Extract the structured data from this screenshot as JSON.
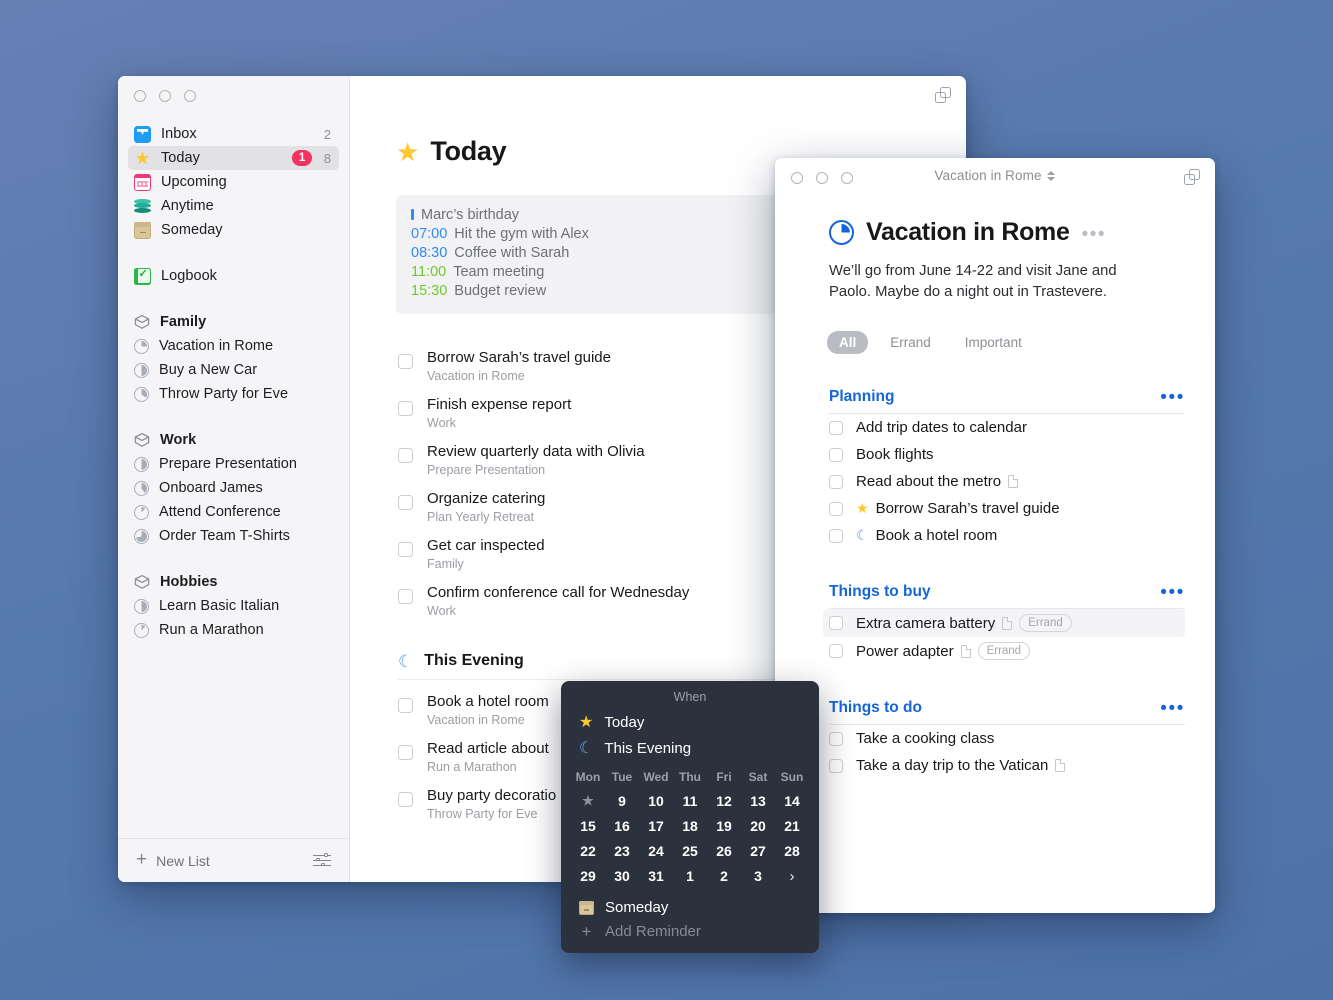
{
  "main_window": {
    "title": "",
    "duplicate_icon": "duplicate-icon",
    "sidebar": {
      "nav": [
        {
          "label": "Inbox",
          "icon": "inbox-icon",
          "count": "2",
          "badge": "",
          "selected": false
        },
        {
          "label": "Today",
          "icon": "star-icon",
          "count": "8",
          "badge": "1",
          "selected": true
        },
        {
          "label": "Upcoming",
          "icon": "calendar-icon",
          "count": "",
          "badge": "",
          "selected": false
        },
        {
          "label": "Anytime",
          "icon": "layers-icon",
          "count": "",
          "badge": "",
          "selected": false
        },
        {
          "label": "Someday",
          "icon": "archive-icon",
          "count": "",
          "badge": "",
          "selected": false
        },
        {
          "label": "Logbook",
          "icon": "logbook-icon",
          "count": "",
          "badge": "",
          "selected": false
        }
      ],
      "areas": [
        {
          "label": "Family",
          "icon": "area-icon",
          "projects": [
            {
              "label": "Vacation in Rome",
              "progress": 25
            },
            {
              "label": "Buy a New Car",
              "progress": 50
            },
            {
              "label": "Throw Party for Eve",
              "progress": 35
            }
          ]
        },
        {
          "label": "Work",
          "icon": "area-icon",
          "projects": [
            {
              "label": "Prepare Presentation",
              "progress": 50
            },
            {
              "label": "Onboard James",
              "progress": 40
            },
            {
              "label": "Attend Conference",
              "progress": 12
            },
            {
              "label": "Order Team T-Shirts",
              "progress": 72
            }
          ]
        },
        {
          "label": "Hobbies",
          "icon": "area-icon",
          "projects": [
            {
              "label": "Learn Basic Italian",
              "progress": 50
            },
            {
              "label": "Run a Marathon",
              "progress": 12
            }
          ]
        }
      ],
      "footer": {
        "new_list_label": "New List",
        "plus_icon": "plus-icon",
        "settings_icon": "sliders-icon"
      }
    },
    "today": {
      "title": "Today",
      "star_icon": "star-icon",
      "events": [
        {
          "time": "",
          "time_color": "",
          "marker": true,
          "label": "Marc’s birthday"
        },
        {
          "time": "07:00",
          "time_color": "blue",
          "marker": false,
          "label": "Hit the gym with Alex"
        },
        {
          "time": "08:30",
          "time_color": "blue",
          "marker": false,
          "label": "Coffee with Sarah"
        },
        {
          "time": "11:00",
          "time_color": "green",
          "marker": false,
          "label": "Team meeting"
        },
        {
          "time": "15:30",
          "time_color": "green",
          "marker": false,
          "label": "Budget review"
        }
      ],
      "tasks": [
        {
          "title": "Borrow Sarah’s travel guide",
          "project": "Vacation in Rome"
        },
        {
          "title": "Finish expense report",
          "project": "Work"
        },
        {
          "title": "Review quarterly data with Olivia",
          "project": "Prepare Presentation"
        },
        {
          "title": "Organize catering",
          "project": "Plan Yearly Retreat"
        },
        {
          "title": "Get car inspected",
          "project": "Family"
        },
        {
          "title": "Confirm conference call for Wednesday",
          "project": "Work"
        }
      ],
      "evening": {
        "title": "This Evening",
        "moon_icon": "moon-icon",
        "tasks": [
          {
            "title": "Book a hotel room",
            "project": "Vacation in Rome"
          },
          {
            "title": "Read article about",
            "project": "Run a Marathon"
          },
          {
            "title": "Buy party decoratio",
            "project": "Throw Party for Eve"
          }
        ]
      }
    }
  },
  "project_window": {
    "titlebar_title": "Vacation in Rome",
    "duplicate_icon": "duplicate-icon",
    "heading": "Vacation in Rome",
    "progress": 25,
    "more_icon": "•••",
    "note": "We’ll go from June 14-22 and visit Jane and Paolo. Maybe do a night out in Trastevere.",
    "filters": [
      {
        "label": "All",
        "active": true
      },
      {
        "label": "Errand",
        "active": false
      },
      {
        "label": "Important",
        "active": false
      }
    ],
    "sections": [
      {
        "title": "Planning",
        "more_icon": "•••",
        "tasks": [
          {
            "title": "Add trip dates to calendar",
            "flag": "",
            "note": false,
            "tag": "",
            "hover": false
          },
          {
            "title": "Book flights",
            "flag": "",
            "note": false,
            "tag": "",
            "hover": false
          },
          {
            "title": "Read about the metro",
            "flag": "",
            "note": true,
            "tag": "",
            "hover": false
          },
          {
            "title": "Borrow Sarah’s travel guide",
            "flag": "star",
            "note": false,
            "tag": "",
            "hover": false
          },
          {
            "title": "Book a hotel room",
            "flag": "moon",
            "note": false,
            "tag": "",
            "hover": false
          }
        ]
      },
      {
        "title": "Things to buy",
        "more_icon": "•••",
        "tasks": [
          {
            "title": "Extra camera battery",
            "flag": "",
            "note": true,
            "tag": "Errand",
            "hover": true
          },
          {
            "title": "Power adapter",
            "flag": "",
            "note": true,
            "tag": "Errand",
            "hover": false
          }
        ]
      },
      {
        "title": "Things to do",
        "more_icon": "•••",
        "tasks": [
          {
            "title": "Take a cooking class",
            "flag": "",
            "note": false,
            "tag": "",
            "hover": false
          },
          {
            "title": "Take a day trip to the Vatican",
            "flag": "",
            "note": true,
            "tag": "",
            "hover": false
          }
        ]
      }
    ]
  },
  "when_popover": {
    "title": "When",
    "quick": [
      {
        "label": "Today",
        "icon": "star-icon"
      },
      {
        "label": "This Evening",
        "icon": "moon-icon"
      }
    ],
    "day_names": [
      "Mon",
      "Tue",
      "Wed",
      "Thu",
      "Fri",
      "Sat",
      "Sun"
    ],
    "days": [
      "★",
      "9",
      "10",
      "11",
      "12",
      "13",
      "14",
      "15",
      "16",
      "17",
      "18",
      "19",
      "20",
      "21",
      "22",
      "23",
      "24",
      "25",
      "26",
      "27",
      "28",
      "29",
      "30",
      "31",
      "1",
      "2",
      "3",
      "›"
    ],
    "today_cell_index": 0,
    "nav_cell_index": 27,
    "someday": {
      "label": "Someday",
      "icon": "archive-icon"
    },
    "add_reminder": {
      "label": "Add Reminder",
      "icon": "plus-icon"
    }
  },
  "colors": {
    "accent_blue": "#1665d8",
    "badge_red": "#f4315f",
    "star_yellow": "#fdc82f",
    "moon_blue": "#5d9cf8",
    "event_blue": "#2f8bf5",
    "event_green": "#6fc92c",
    "popover_bg": "#2c323d"
  }
}
